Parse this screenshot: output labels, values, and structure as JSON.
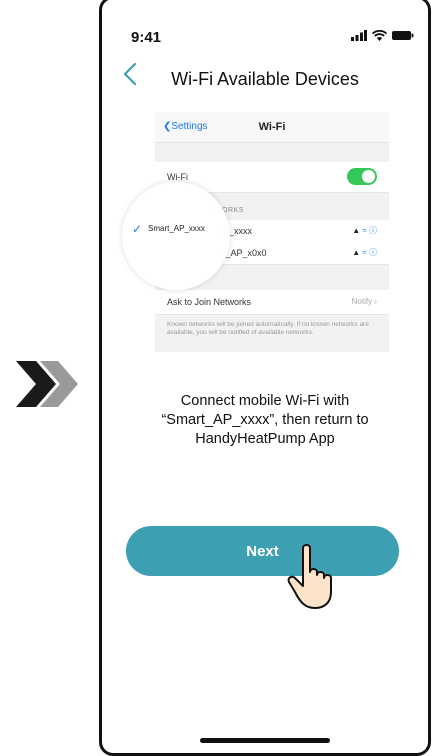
{
  "status_bar": {
    "time": "9:41"
  },
  "header": {
    "title": "Wi-Fi Available Devices"
  },
  "settings_screenshot": {
    "nav_back": "Settings",
    "nav_title": "Wi-Fi",
    "wifi_label": "Wi-Fi",
    "section_header": "WORKS",
    "networks": [
      {
        "name": "P_xxxx"
      },
      {
        "name": "t_AP_x0x0"
      }
    ],
    "ask_label": "Ask to Join Networks",
    "ask_value": "Notify",
    "footnote": "Known networks will be joined automatically. If no known networks are available, you will be notified of available networks.",
    "magnified_network": "Smart_AP_xxxx"
  },
  "instruction": {
    "line1": "Connect mobile Wi-Fi with",
    "line2": "“Smart_AP_xxxx”, then return to",
    "line3": "HandyHeatPump App"
  },
  "next_button": {
    "label": "Next"
  },
  "colors": {
    "accent": "#3d9fb2",
    "toggle_on": "#34c759",
    "link_blue": "#1a7ae8"
  }
}
